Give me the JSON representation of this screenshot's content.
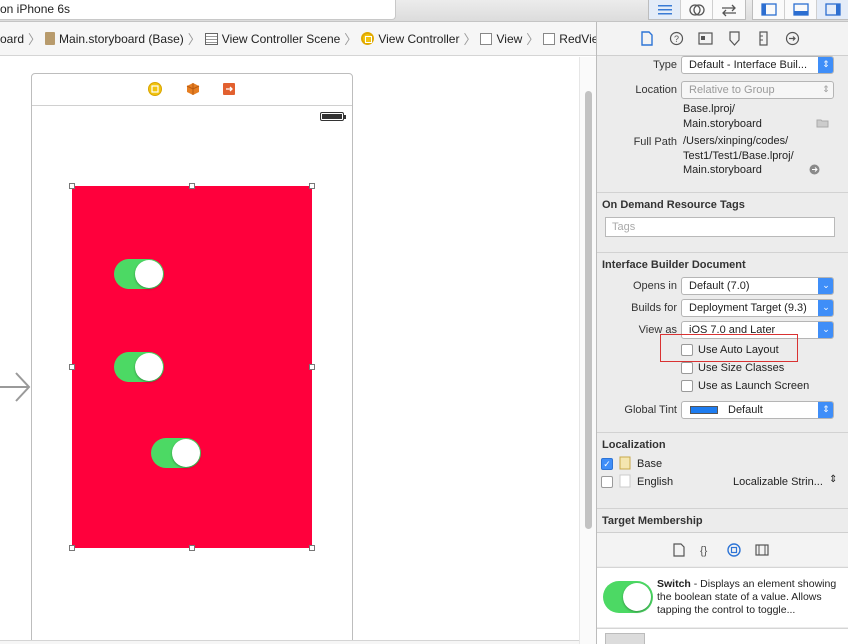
{
  "toolbar": {
    "scheme": "on iPhone 6s"
  },
  "jumpbar": {
    "crumbs": [
      "oard",
      "Main.storyboard (Base)",
      "View Controller Scene",
      "View Controller",
      "View",
      "RedView"
    ]
  },
  "canvas": {
    "view_color": "#ff003c",
    "switch_color": "#4cd964"
  },
  "inspector": {
    "identity": {
      "type_label": "Type",
      "type_value": "Default - Interface Buil...",
      "location_label": "Location",
      "location_value": "Relative to Group",
      "location_path_line1": "Base.lproj/",
      "location_path_line2": "Main.storyboard",
      "fullpath_label": "Full Path",
      "fullpath_line1": "/Users/xinping/codes/",
      "fullpath_line2": "Test1/Test1/Base.lproj/",
      "fullpath_line3": "Main.storyboard"
    },
    "on_demand": {
      "header": "On Demand Resource Tags",
      "tags_placeholder": "Tags"
    },
    "ib_document": {
      "header": "Interface Builder Document",
      "opens_in_label": "Opens in",
      "opens_in_value": "Default (7.0)",
      "builds_for_label": "Builds for",
      "builds_for_value": "Deployment Target (9.3)",
      "view_as_label": "View as",
      "view_as_value": "iOS 7.0 and Later",
      "use_auto_layout": "Use Auto Layout",
      "use_size_classes": "Use Size Classes",
      "use_launch_screen": "Use as Launch Screen",
      "global_tint_label": "Global Tint",
      "global_tint_value": "Default"
    },
    "localization": {
      "header": "Localization",
      "base": "Base",
      "english": "English",
      "english_value": "Localizable Strin..."
    },
    "target_membership": {
      "header": "Target Membership"
    },
    "library": {
      "switch_title": "Switch",
      "switch_desc": " - Displays an element showing the boolean state of a value. Allows tapping the control to toggle..."
    }
  }
}
